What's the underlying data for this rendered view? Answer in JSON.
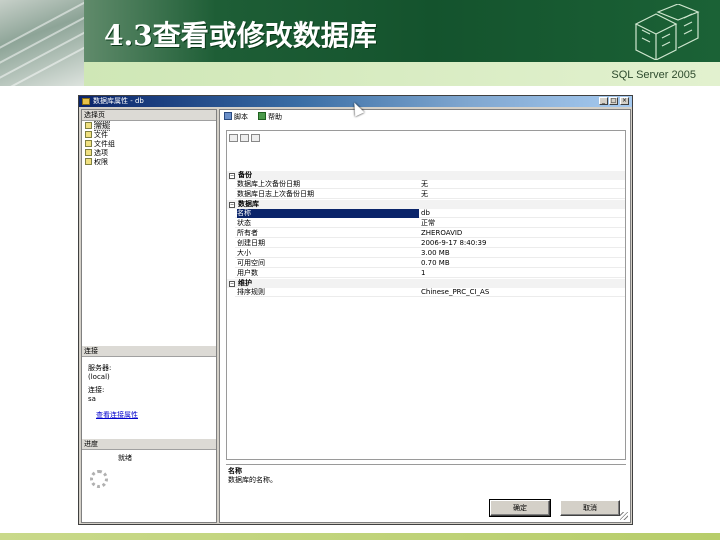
{
  "slide": {
    "title": "4.3查看或修改数据库",
    "subtitle": "SQL Server 2005"
  },
  "dialog": {
    "title": "数据库属性 - db",
    "window_buttons": [
      "_",
      "□",
      "×"
    ],
    "select_page_header": "选择页",
    "nav_items": [
      {
        "label": "常规",
        "selected": true
      },
      {
        "label": "文件",
        "selected": false
      },
      {
        "label": "文件组",
        "selected": false
      },
      {
        "label": "选项",
        "selected": false
      },
      {
        "label": "权限",
        "selected": false
      }
    ],
    "connection_header": "连接",
    "server_label": "服务器:",
    "server_value": "(local)",
    "connection_label": "连接:",
    "connection_value": "sa",
    "view_connection_link": "查看连接属性",
    "progress_header": "进度",
    "progress_status": "就绪",
    "toolbar": {
      "script_label": "脚本",
      "help_label": "帮助"
    },
    "categories": [
      {
        "name": "备份",
        "rows": [
          {
            "name": "数据库上次备份日期",
            "value": "无",
            "selected": false
          },
          {
            "name": "数据库日志上次备份日期",
            "value": "无",
            "selected": false
          }
        ]
      },
      {
        "name": "数据库",
        "rows": [
          {
            "name": "名称",
            "value": "db",
            "selected": true
          },
          {
            "name": "状态",
            "value": "正常",
            "selected": false
          },
          {
            "name": "所有者",
            "value": "ZHEROAVID",
            "selected": false
          },
          {
            "name": "创建日期",
            "value": "2006-9-17 8:40:39",
            "selected": false
          },
          {
            "name": "大小",
            "value": "3.00 MB",
            "selected": false
          },
          {
            "name": "可用空间",
            "value": "0.70 MB",
            "selected": false
          },
          {
            "name": "用户数",
            "value": "1",
            "selected": false
          }
        ]
      },
      {
        "name": "维护",
        "rows": [
          {
            "name": "排序规则",
            "value": "Chinese_PRC_CI_AS",
            "selected": false
          }
        ]
      }
    ],
    "description": {
      "name": "名称",
      "text": "数据库的名称。"
    },
    "ok_button": "确定",
    "cancel_button": "取消"
  }
}
